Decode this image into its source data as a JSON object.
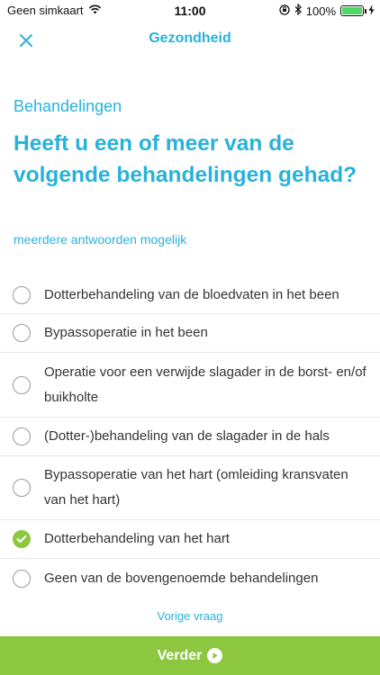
{
  "status_bar": {
    "carrier": "Geen simkaart",
    "time": "11:00",
    "battery": "100%",
    "battery_level": 1.0
  },
  "nav": {
    "title": "Gezondheid",
    "close_icon": "close-icon"
  },
  "section_label": "Behandelingen",
  "question": "Heeft u een of meer van de volgende behandelingen gehad?",
  "hint": "meerdere antwoorden mogelijk",
  "options": [
    {
      "label": "Dotterbehandeling van de bloedvaten in het been",
      "checked": false
    },
    {
      "label": "Bypassoperatie in het been",
      "checked": false
    },
    {
      "label": "Operatie voor een verwijde slagader in de borst- en/of buikholte",
      "checked": false
    },
    {
      "label": "(Dotter-)behandeling van de slagader in de hals",
      "checked": false
    },
    {
      "label": "Bypassoperatie van het hart (omleiding kransvaten van het hart)",
      "checked": false
    },
    {
      "label": "Dotterbehandeling van het hart",
      "checked": true
    },
    {
      "label": "Geen van de bovengenoemde behandelingen",
      "checked": false
    }
  ],
  "prev_link": "Vorige vraag",
  "next_button": "Verder",
  "colors": {
    "accent": "#29b2d9",
    "green": "#8dc63f"
  }
}
